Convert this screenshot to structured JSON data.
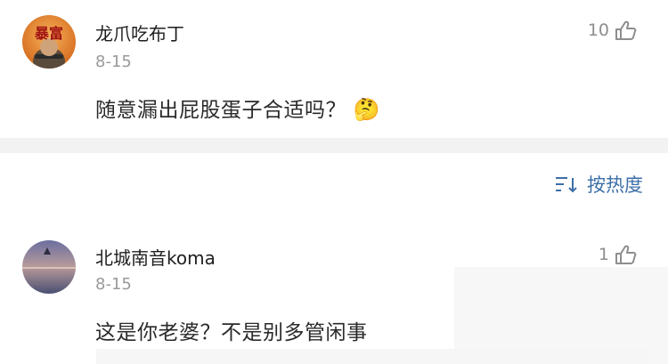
{
  "comments": [
    {
      "avatar_text": "暴富",
      "username": "龙爪吃布丁",
      "date": "8-15",
      "text": "随意漏出屁股蛋子合适吗？",
      "emoji": "🤔",
      "likes": "10"
    },
    {
      "username": "北城南音koma",
      "date": "8-15",
      "text": "这是你老婆？不是别多管闲事",
      "likes": "1"
    }
  ],
  "sort": {
    "label": "按热度",
    "icon": "sort-icon"
  },
  "colors": {
    "link": "#3d6fa8",
    "muted": "#9a9a9a",
    "divider": "#f2f2f2"
  }
}
